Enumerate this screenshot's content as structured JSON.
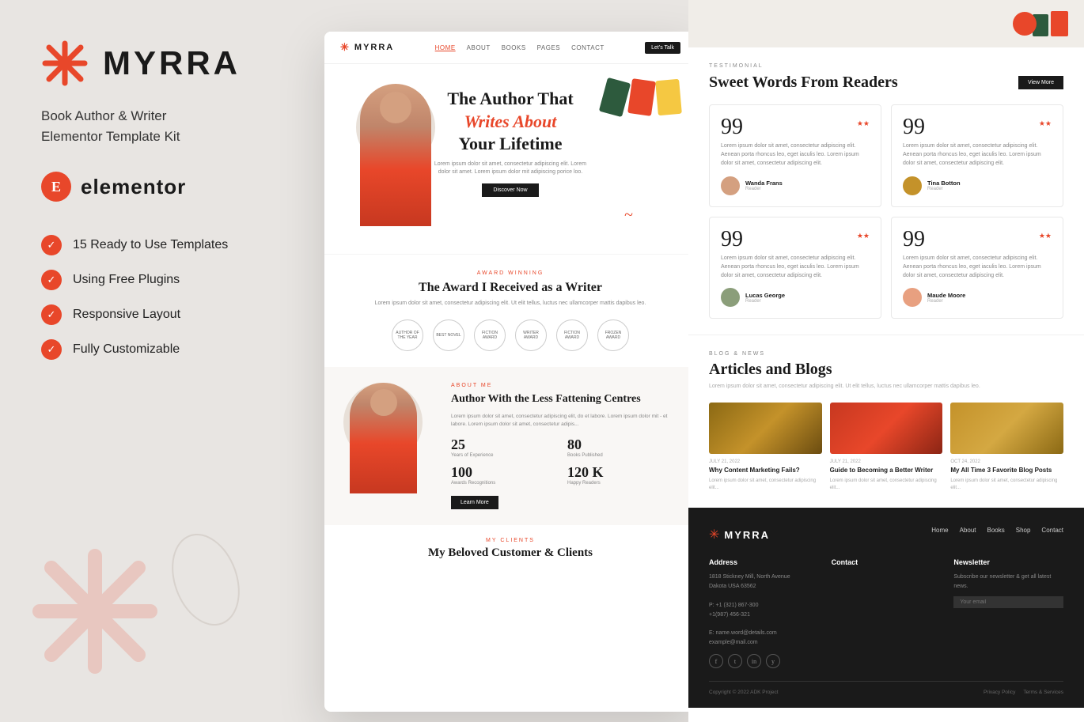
{
  "brand": {
    "name": "MYRRA",
    "tagline_line1": "Book Author & Writer",
    "tagline_line2": "Elementor Template Kit",
    "elementor_label": "elementor"
  },
  "features": {
    "title": "Ready to Use Templates",
    "items": [
      {
        "label": "15 Ready to Use Templates"
      },
      {
        "label": "Using Free Plugins"
      },
      {
        "label": "Responsive Layout"
      },
      {
        "label": "Fully Customizable"
      }
    ]
  },
  "site": {
    "nav": {
      "links": [
        "HOME",
        "ABOUT",
        "BOOKS",
        "PAGES",
        "CONTACT"
      ],
      "cta": "Let's Talk"
    },
    "hero": {
      "line1": "The Author That",
      "line2": "Writes About",
      "line3": "Your Lifetime",
      "description": "Lorem ipsum dolor sit amet, consectetur adipiscing elit. Lorem dolor sit amet. Lorem ipsum dolor mit adipiscing porice loo.",
      "btn_label": "Discover Now"
    },
    "awards": {
      "eyebrow": "AWARD WINNING",
      "title": "The Award I Received as a Writer",
      "description": "Lorem ipsum dolor sit amet, consectetur adipiscing elit. Ut elit tellus, luctus nec ullamcorper mattis dapibus leo.",
      "badges": [
        "AUTHOR OF THE YEAR",
        "BEST NOVEL",
        "FICTION AWARD",
        "WRITER AWARD",
        "FICTION AWARD",
        "FROZEN AWARD"
      ]
    },
    "about": {
      "eyebrow": "ABOUT ME",
      "title": "Author With the Less Fattening Centres",
      "description": "Lorem ipsum dolor sit amet, consectetur adipiscing elit, do et labore. Lorem ipsum dolor mit - et labore. Lorem ipsum dolor sit amet, consectetur adipis...",
      "stats": [
        {
          "number": "25",
          "label": "Years of Experience"
        },
        {
          "number": "80",
          "label": "Books Published"
        },
        {
          "number": "100",
          "label": "Awards Recognitions"
        },
        {
          "number": "120 K",
          "label": "Happy Readers"
        }
      ],
      "btn_label": "Learn More"
    },
    "clients": {
      "eyebrow": "MY CLIENTS",
      "title": "My Beloved Customer & Clients"
    }
  },
  "testimonials": {
    "eyebrow": "TESTIMONIAL",
    "title": "Sweet Words From Readers",
    "view_more": "View More",
    "items": [
      {
        "quote": "Lorem ipsum dolor sit amet, consectetur adipiscing elit. Aenean porta rhoncus leo, eget iaculis leo. Lorem ipsum dolor sit amet, consectetur adipiscing elit.",
        "stars": "★★",
        "author": "Wanda Frans",
        "role": "Reader",
        "avatar_color": "#d4a080"
      },
      {
        "quote": "Lorem ipsum dolor sit amet, consectetur adipiscing elit. Aenean porta rhoncus leo, eget iaculis leo. Lorem ipsum dolor sit amet, consectetur adipiscing elit.",
        "stars": "★★",
        "author": "Tina Botton",
        "role": "Reader",
        "avatar_color": "#c4922a"
      },
      {
        "quote": "Lorem ipsum dolor sit amet, consectetur adipiscing elit. Aenean porta rhoncus leo, eget iaculis leo. Lorem ipsum dolor sit amet, consectetur adipiscing elit.",
        "stars": "★★",
        "author": "Lucas George",
        "role": "Reader",
        "avatar_color": "#8B9E7A"
      },
      {
        "quote": "Lorem ipsum dolor sit amet, consectetur adipiscing elit. Aenean porta rhoncus leo, eget iaculis leo. Lorem ipsum dolor sit amet, consectetur adipiscing elit.",
        "stars": "★★",
        "author": "Maude Moore",
        "role": "Reader",
        "avatar_color": "#e8a080"
      }
    ]
  },
  "blog": {
    "eyebrow": "BLOG & NEWS",
    "title": "Articles and Blogs",
    "description": "Lorem ipsum dolor sit amet, consectetur adipiscing elit. Ut elit tellus, luctus nec ullamcorper mattis dapibus leo.",
    "posts": [
      {
        "date": "JULY 21, 2022",
        "title": "Why Content Marketing Fails?",
        "description": "Lorem ipsum dolor sit amet, consectetur adipiscing elit..."
      },
      {
        "date": "JULY 21, 2022",
        "title": "Guide to Becoming a Better Writer",
        "description": "Lorem ipsum dolor sit amet, consectetur adipiscing elit..."
      },
      {
        "date": "OCT 24, 2022",
        "title": "My All Time 3 Favorite Blog Posts",
        "description": "Lorem ipsum dolor sit amet, consectetur adipiscing elit..."
      }
    ]
  },
  "footer": {
    "logo": "MYRRA",
    "nav_links": [
      "Home",
      "About",
      "Books",
      "Shop",
      "Contact"
    ],
    "columns": [
      {
        "title": "Address",
        "lines": [
          "1818 Stickney Mill, North Avenue",
          "Dakota USA 63562",
          "",
          "P: +1 (321) 867-300",
          "+1(987) 456-321",
          "",
          "E: name.word@details.com",
          "example@mail.com"
        ]
      },
      {
        "title": "Contact",
        "lines": []
      },
      {
        "title": "Newsletter",
        "lines": [
          "Subscribe our newsletter & get all latest news.",
          "Your email"
        ]
      }
    ],
    "social": [
      "f",
      "t",
      "in",
      "y"
    ],
    "copyright": "Copyright © 2022 ADK Project",
    "privacy": "Privacy Policy",
    "terms": "Terms & Services"
  },
  "colors": {
    "accent": "#e8472a",
    "dark": "#1a1a1a",
    "bg": "#e8e5e2"
  }
}
